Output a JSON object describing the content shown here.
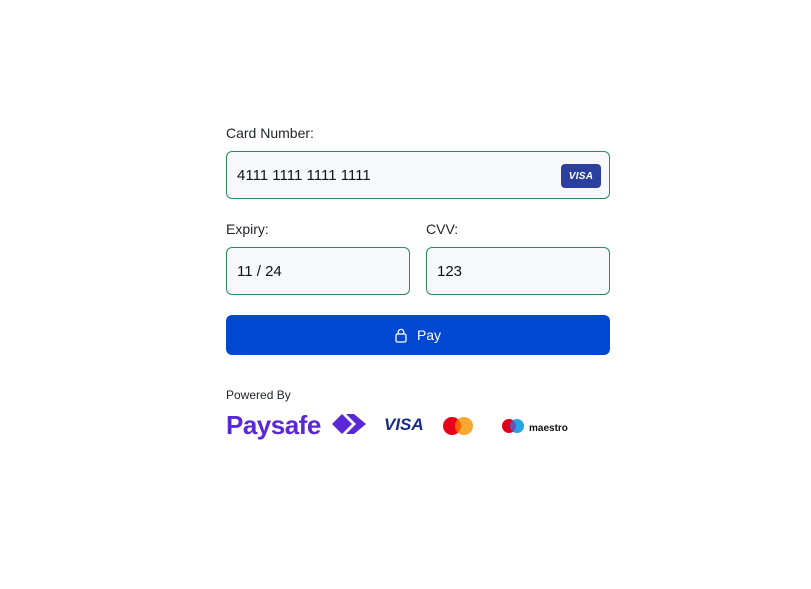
{
  "form": {
    "card_number": {
      "label": "Card Number:",
      "value": "4111 1111 1111 1111",
      "brand_badge": "VISA"
    },
    "expiry": {
      "label": "Expiry:",
      "value": "11 / 24"
    },
    "cvv": {
      "label": "CVV:",
      "value": "123"
    },
    "pay_button": {
      "label": "Pay",
      "icon": "lock-icon"
    }
  },
  "footer": {
    "powered_by": "Powered By",
    "paysafe_wordmark": "Paysafe",
    "logos": {
      "visa": "VISA",
      "mastercard_icon": "mastercard-icon",
      "maestro": "maestro"
    }
  },
  "colors": {
    "field_border": "#2e8b57",
    "field_bg": "#f6f8fb",
    "pay_button": "#0047d1",
    "paysafe": "#5a28d6",
    "visa_blue": "#1a2a8c"
  }
}
